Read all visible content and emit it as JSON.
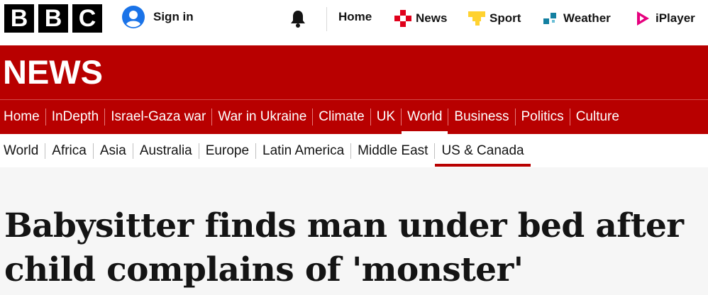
{
  "brand": {
    "letters": [
      "B",
      "B",
      "C"
    ]
  },
  "account": {
    "signin_label": "Sign in",
    "icon": "user-icon"
  },
  "notifications": {
    "icon": "bell-icon"
  },
  "top_nav": [
    {
      "label": "Home",
      "icon": ""
    },
    {
      "label": "News",
      "icon": "news-icon",
      "color": "#e0001b"
    },
    {
      "label": "Sport",
      "icon": "sport-icon",
      "color": "#ffd230"
    },
    {
      "label": "Weather",
      "icon": "weather-icon",
      "color": "#1380a1"
    },
    {
      "label": "iPlayer",
      "icon": "iplayer-icon",
      "color": "#e6007e"
    }
  ],
  "masthead": {
    "title": "NEWS",
    "color": "#b80000"
  },
  "primary_nav": [
    {
      "label": "Home"
    },
    {
      "label": "InDepth"
    },
    {
      "label": "Israel-Gaza war"
    },
    {
      "label": "War in Ukraine"
    },
    {
      "label": "Climate"
    },
    {
      "label": "UK"
    },
    {
      "label": "World",
      "active": true
    },
    {
      "label": "Business"
    },
    {
      "label": "Politics"
    },
    {
      "label": "Culture"
    }
  ],
  "secondary_nav": [
    {
      "label": "World"
    },
    {
      "label": "Africa"
    },
    {
      "label": "Asia"
    },
    {
      "label": "Australia"
    },
    {
      "label": "Europe"
    },
    {
      "label": "Latin America"
    },
    {
      "label": "Middle East"
    },
    {
      "label": "US & Canada",
      "active": true
    }
  ],
  "article": {
    "headline": "Babysitter finds man under bed after child complains of 'monster'"
  }
}
